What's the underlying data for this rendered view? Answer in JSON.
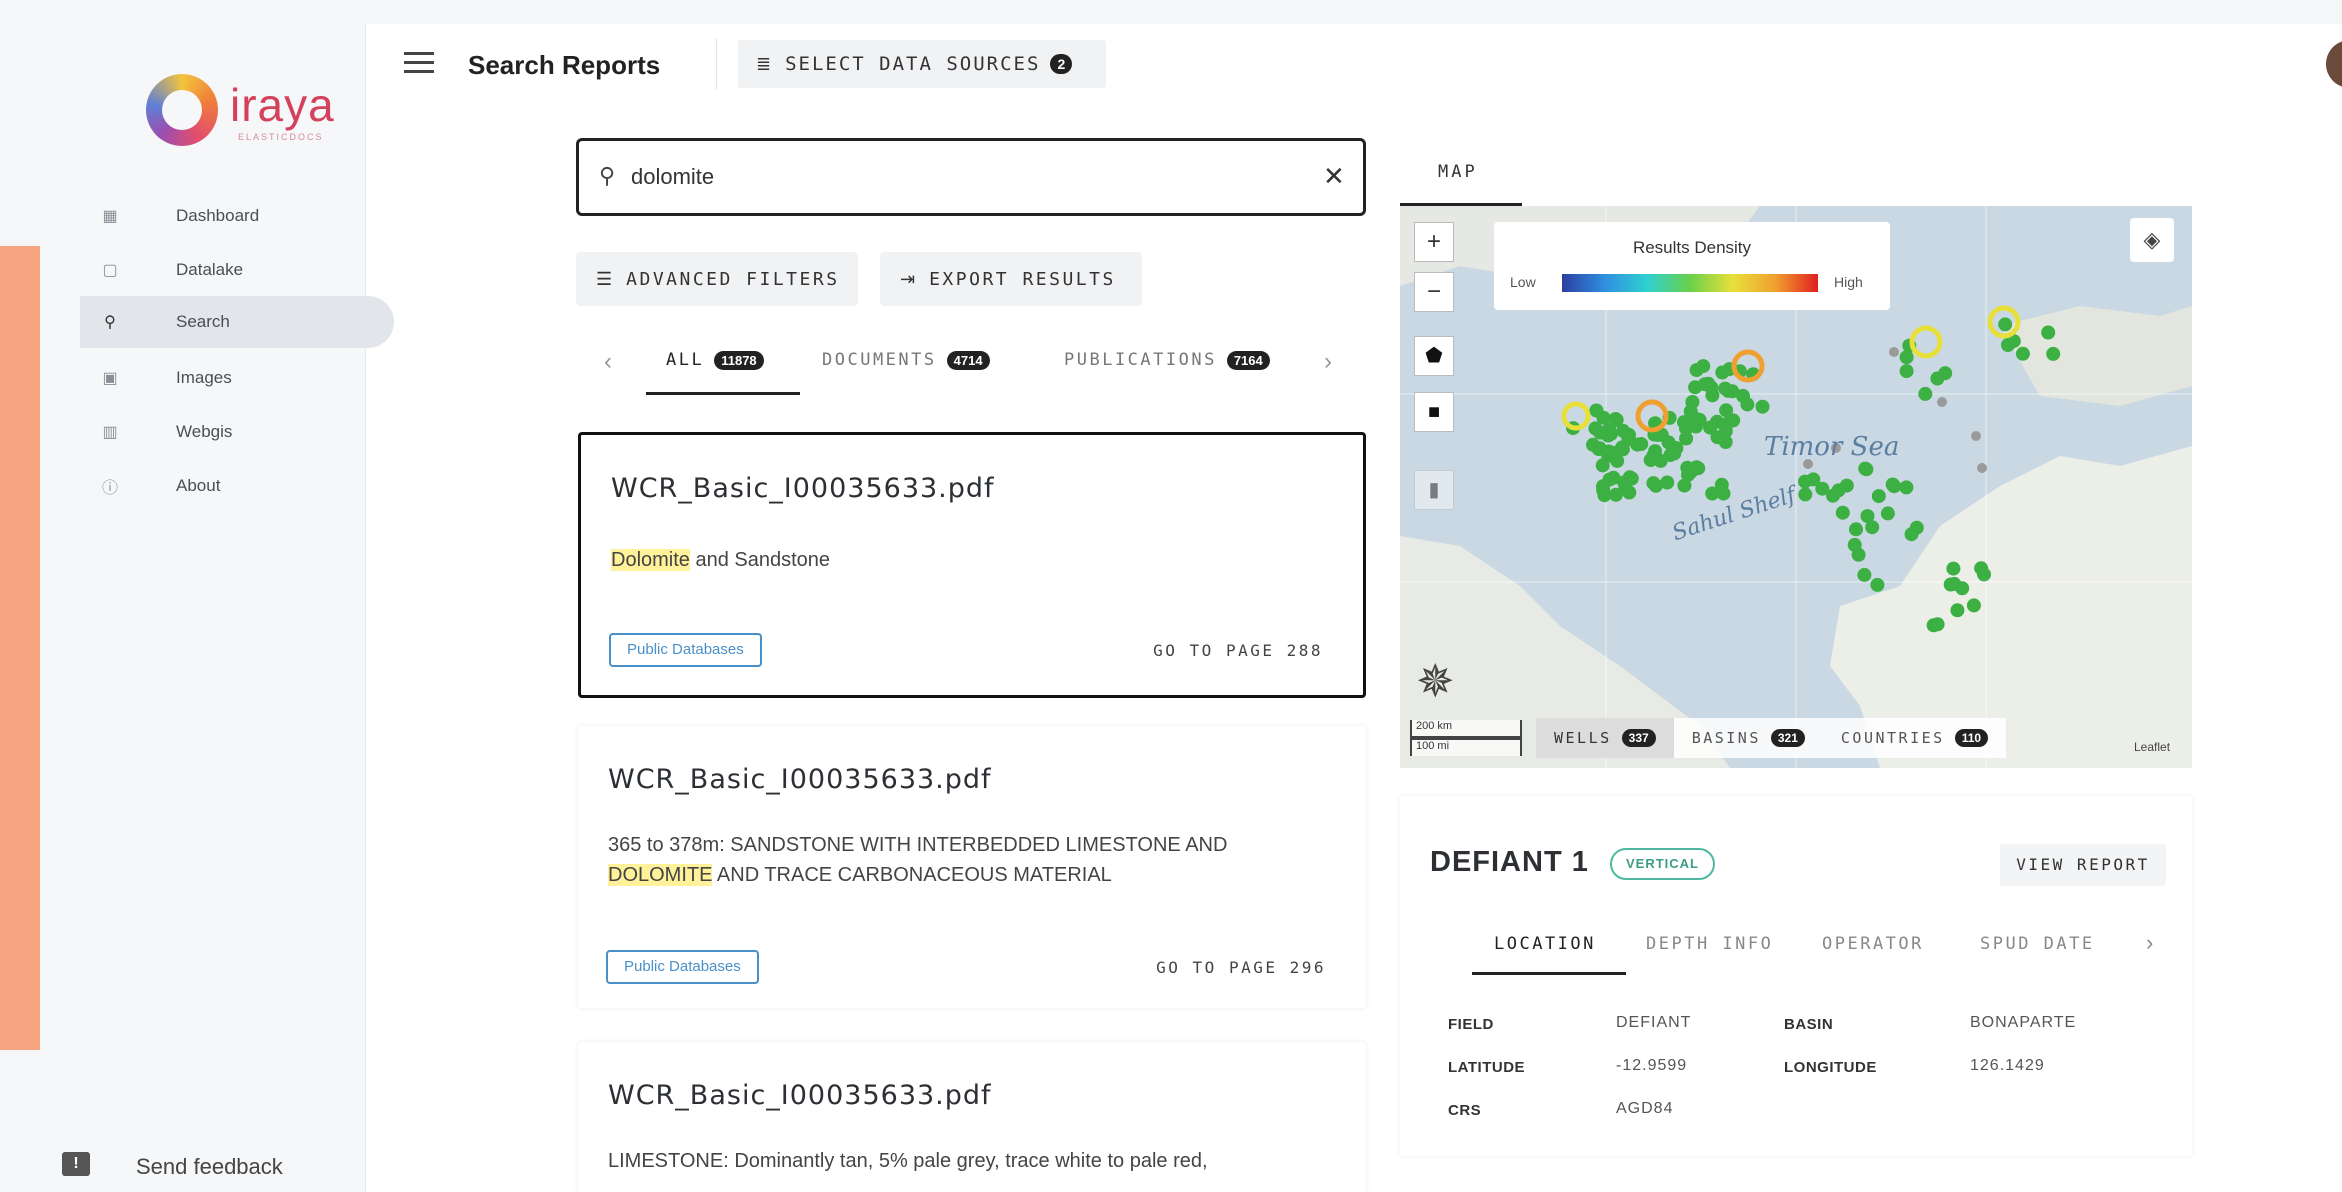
{
  "app": {
    "logo_text": "iraya",
    "logo_sub": "ELASTICDOCS",
    "page_title": "Search Reports",
    "select_sources": {
      "label": "SELECT DATA SOURCES",
      "count": "2"
    }
  },
  "sidebar": {
    "items": [
      {
        "label": "Dashboard",
        "icon": "dashboard-icon"
      },
      {
        "label": "Datalake",
        "icon": "datalake-icon"
      },
      {
        "label": "Search",
        "icon": "search-icon",
        "active": true
      },
      {
        "label": "Images",
        "icon": "image-icon"
      },
      {
        "label": "Webgis",
        "icon": "map-icon"
      },
      {
        "label": "About",
        "icon": "info-icon"
      }
    ],
    "feedback": "Send feedback"
  },
  "search": {
    "value": "dolomite",
    "advanced_filters": "ADVANCED FILTERS",
    "export_results": "EXPORT RESULTS"
  },
  "tabs": [
    {
      "label": "ALL",
      "count": "11878",
      "active": true
    },
    {
      "label": "DOCUMENTS",
      "count": "4714"
    },
    {
      "label": "PUBLICATIONS",
      "count": "7164"
    }
  ],
  "results": [
    {
      "title": "WCR_Basic_I00035633.pdf",
      "pre": "",
      "highlight": "Dolomite",
      "post": " and Sandstone",
      "tag": "Public Databases",
      "goto": "GO TO PAGE 288"
    },
    {
      "title": "WCR_Basic_I00035633.pdf",
      "line1": "365 to 378m: SANDSTONE WITH INTERBEDDED LIMESTONE AND",
      "highlight": "DOLOMITE",
      "post": " AND TRACE CARBONACEOUS MATERIAL",
      "tag": "Public Databases",
      "goto": "GO TO PAGE 296"
    },
    {
      "title": "WCR_Basic_I00035633.pdf",
      "line1": "LIMESTONE: Dominantly tan, 5% pale grey, trace white to pale red,"
    }
  ],
  "map": {
    "tab": "MAP",
    "legend": {
      "title": "Results Density",
      "low": "Low",
      "high": "High"
    },
    "zoom_in": "+",
    "zoom_out": "−",
    "scale_km": "200 km",
    "scale_mi": "100 mi",
    "labels": {
      "sea": "Timor Sea",
      "shelf": "Sahul Shelf"
    },
    "filters": [
      {
        "label": "WELLS",
        "count": "337",
        "active": true
      },
      {
        "label": "BASINS",
        "count": "321"
      },
      {
        "label": "COUNTRIES",
        "count": "110"
      }
    ],
    "attribution": "Leaflet"
  },
  "detail": {
    "title": "DEFIANT 1",
    "badge": "VERTICAL",
    "view_report": "VIEW REPORT",
    "tabs": [
      "LOCATION",
      "DEPTH INFO",
      "OPERATOR",
      "SPUD DATE"
    ],
    "fields": {
      "field_label": "FIELD",
      "field_value": "DEFIANT",
      "basin_label": "BASIN",
      "basin_value": "BONAPARTE",
      "lat_label": "LATITUDE",
      "lat_value": "-12.9599",
      "lon_label": "LONGITUDE",
      "lon_value": "126.1429",
      "crs_label": "CRS",
      "crs_value": "AGD84"
    }
  },
  "colors": {
    "accent": "#222222",
    "link_blue": "#4a90c8",
    "highlight": "#fff29a",
    "well_green": "#3cb043",
    "vertical_teal": "#4fb8a0"
  }
}
